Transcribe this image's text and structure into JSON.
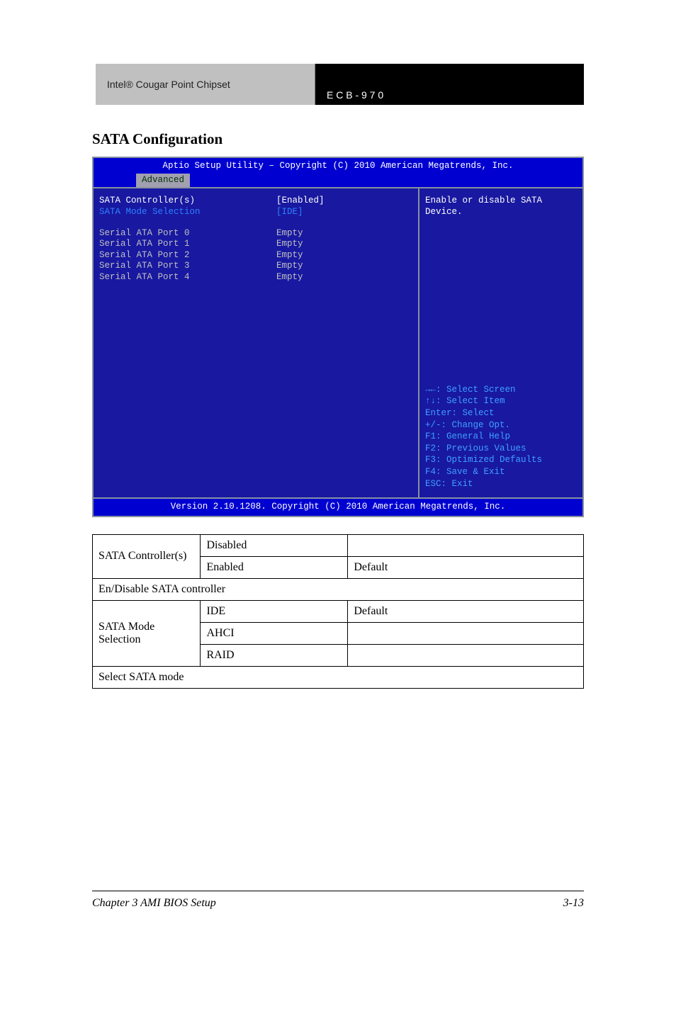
{
  "header": {
    "left": "Intel® Cougar Point Chipset",
    "right": "E C B - 9 7 0"
  },
  "section_heading": "SATA Configuration",
  "bios": {
    "title": "Aptio Setup Utility – Copyright (C) 2010 American Megatrends, Inc.",
    "tab": "Advanced",
    "footer": "Version 2.10.1208. Copyright (C) 2010 American Megatrends, Inc.",
    "settings": [
      {
        "label": "SATA Controller(s)",
        "value": "[Enabled]",
        "sel": true
      },
      {
        "label": "SATA Mode Selection",
        "value": "[IDE]",
        "sel": false
      }
    ],
    "ports": [
      {
        "label": "Serial ATA Port 0",
        "value": "Empty"
      },
      {
        "label": "Serial ATA Port 1",
        "value": "Empty"
      },
      {
        "label": "Serial ATA Port 2",
        "value": "Empty"
      },
      {
        "label": "Serial ATA Port 3",
        "value": "Empty"
      },
      {
        "label": "Serial ATA Port 4",
        "value": "Empty"
      }
    ],
    "help_top": "Enable or disable SATA Device.",
    "help_keys": [
      "→←: Select Screen",
      "↑↓: Select Item",
      "Enter: Select",
      "+/-: Change Opt.",
      "F1: General Help",
      "F2: Previous Values",
      "F3: Optimized Defaults",
      "F4: Save & Exit",
      "ESC: Exit"
    ]
  },
  "options_table": {
    "rows": [
      {
        "name": "SATA Controller(s)",
        "opts": [
          {
            "opt": "Disabled",
            "desc": ""
          },
          {
            "opt": "Enabled",
            "desc": "Default"
          }
        ],
        "desc_full": "En/Disable SATA controller"
      },
      {
        "name": "SATA Mode Selection",
        "opts": [
          {
            "opt": "IDE",
            "desc": "Default"
          },
          {
            "opt": "AHCI",
            "desc": ""
          },
          {
            "opt": "RAID",
            "desc": ""
          }
        ],
        "desc_full": "Select SATA mode"
      }
    ]
  },
  "footer": {
    "left": "Chapter 3 AMI BIOS Setup",
    "right": "3-13"
  }
}
